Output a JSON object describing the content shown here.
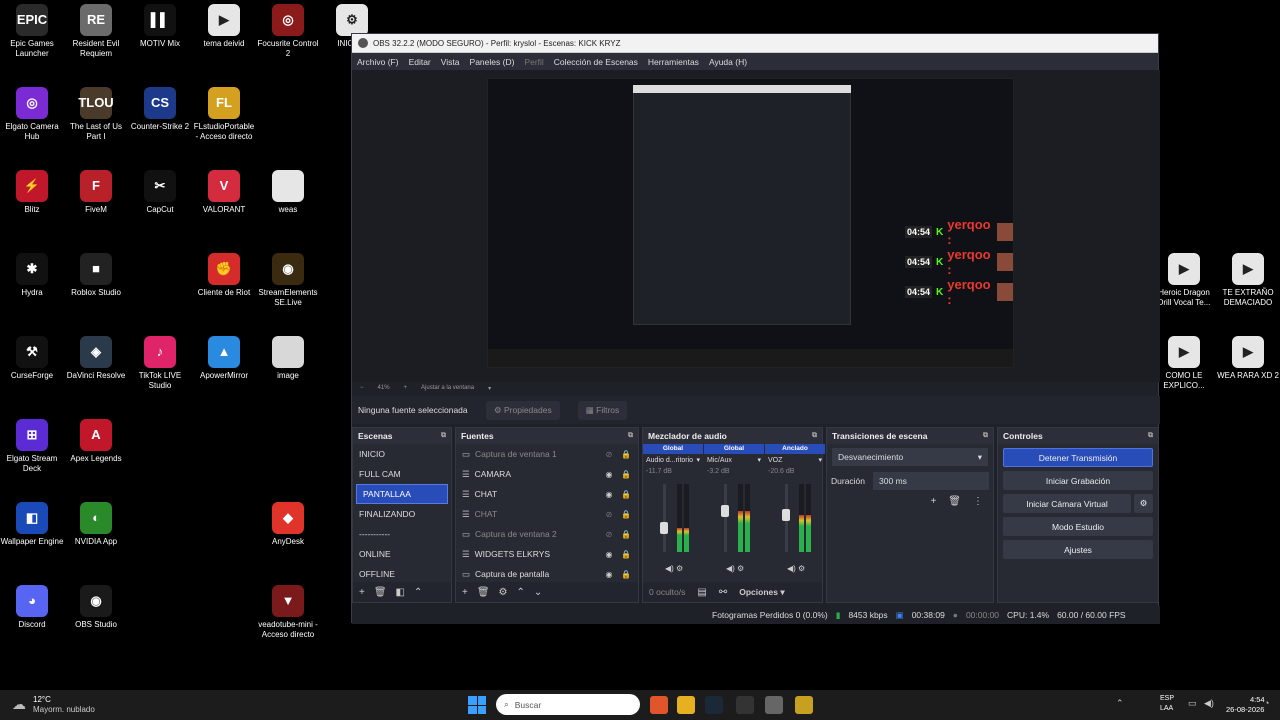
{
  "desktop": {
    "icons": [
      {
        "label": "Epic Games Launcher",
        "glyph": "EPIC",
        "color": "#2a2a2a"
      },
      {
        "label": "Resident Evil Requiem",
        "glyph": "RE",
        "color": "#6b6b6b"
      },
      {
        "label": "MOTIV Mix",
        "glyph": "▌▌",
        "color": "#111111"
      },
      {
        "label": "tema deivid",
        "glyph": "▶",
        "color": "#e6e6e6"
      },
      {
        "label": "Focusrite Control 2",
        "glyph": "◎",
        "color": "#8b1a1a"
      },
      {
        "label": "INICIAR",
        "glyph": "⚙",
        "color": "#e6e6e6"
      },
      {
        "label": "Elgato Camera Hub",
        "glyph": "◎",
        "color": "#7b2bd4"
      },
      {
        "label": "The Last of Us Part I",
        "glyph": "TLOU",
        "color": "#4a3a2a"
      },
      {
        "label": "Counter-Strike 2",
        "glyph": "CS",
        "color": "#1d3a8a"
      },
      {
        "label": "FLstudioPortable - Acceso directo",
        "glyph": "FL",
        "color": "#d4a020"
      },
      {
        "label": "Blitz",
        "glyph": "⚡",
        "color": "#c0182a"
      },
      {
        "label": "FiveM",
        "glyph": "F",
        "color": "#b8202a"
      },
      {
        "label": "CapCut",
        "glyph": "✂",
        "color": "#111111"
      },
      {
        "label": "VALORANT",
        "glyph": "V",
        "color": "#d42b3f"
      },
      {
        "label": "weas",
        "glyph": "",
        "color": "#e6e6e6"
      },
      {
        "label": "Hydra",
        "glyph": "✱",
        "color": "#111111"
      },
      {
        "label": "Roblox Studio",
        "glyph": "■",
        "color": "#222222"
      },
      {
        "label": "Cliente de Riot",
        "glyph": "✊",
        "color": "#d62b2b"
      },
      {
        "label": "StreamElements SE.Live",
        "glyph": "◉",
        "color": "#3a2a10"
      },
      {
        "label": "CurseForge",
        "glyph": "⚒",
        "color": "#111111"
      },
      {
        "label": "DaVinci Resolve",
        "glyph": "◈",
        "color": "#2a3a4a"
      },
      {
        "label": "TikTok LIVE Studio",
        "glyph": "♪",
        "color": "#e0246a"
      },
      {
        "label": "ApowerMirror",
        "glyph": "▲",
        "color": "#2a8ae0"
      },
      {
        "label": "image",
        "glyph": "",
        "color": "#d8d8d8"
      },
      {
        "label": "Elgato Stream Deck",
        "glyph": "⊞",
        "color": "#5b2bd4"
      },
      {
        "label": "Apex Legends",
        "glyph": "A",
        "color": "#c0182a"
      },
      {
        "label": "Wallpaper Engine",
        "glyph": "◧",
        "color": "#1a4ab8"
      },
      {
        "label": "NVIDIA App",
        "glyph": "◐",
        "color": "#2a8a2a"
      },
      {
        "label": "AnyDesk",
        "glyph": "◆",
        "color": "#e0342a"
      },
      {
        "label": "Discord",
        "glyph": "◕",
        "color": "#5865f2"
      },
      {
        "label": "OBS Studio",
        "glyph": "◉",
        "color": "#1a1a1a"
      },
      {
        "label": "veadotube-mini - Acceso directo",
        "glyph": "▼",
        "color": "#7a1a1a"
      },
      {
        "label": "Heroic Dragon Drill Vocal Te...",
        "glyph": "▶",
        "color": "#e6e6e6"
      },
      {
        "label": "TE EXTRAÑO DEMACIADO",
        "glyph": "▶",
        "color": "#e6e6e6"
      },
      {
        "label": "COMO LE EXPLICO...",
        "glyph": "▶",
        "color": "#e6e6e6"
      },
      {
        "label": "WEA RARA XD 2",
        "glyph": "▶",
        "color": "#e6e6e6"
      }
    ]
  },
  "obs": {
    "title": "OBS 32.2.2 (MODO SEGURO) - Perfil: kryslol - Escenas: KICK KRYZ",
    "menu": [
      "Archivo (F)",
      "Editar",
      "Vista",
      "Paneles (D)",
      "Perfil",
      "Colección de Escenas",
      "Herramientas",
      "Ayuda (H)"
    ],
    "zoom": "41%",
    "zoom_fit": "Ajustar a la ventana",
    "no_source": "Ninguna fuente seleccionada",
    "properties": "Propiedades",
    "filters": "Filtros",
    "scenes": {
      "title": "Escenas",
      "items": [
        "INICIO",
        "FULL CAM",
        "PANTALLAA",
        "FINALIZANDO",
        "-----------",
        "ONLINE",
        "OFFLINE"
      ],
      "selected": 2
    },
    "sources": {
      "title": "Fuentes",
      "items": [
        {
          "name": "Captura de ventana 1",
          "visible": false
        },
        {
          "name": "CAMARA",
          "visible": true
        },
        {
          "name": "CHAT",
          "visible": true
        },
        {
          "name": "CHAT",
          "visible": false
        },
        {
          "name": "Captura de ventana 2",
          "visible": false
        },
        {
          "name": "WIDGETS ELKRYS",
          "visible": true
        },
        {
          "name": "Captura de pantalla",
          "visible": true
        }
      ]
    },
    "mixer": {
      "title": "Mezclador de audio",
      "channels": [
        {
          "group": "Global",
          "name": "Audio d...ritorio",
          "db": "-11.7 dB",
          "level": 0.35
        },
        {
          "group": "Global",
          "name": "Mic/Aux",
          "db": "-3.2 dB",
          "level": 0.6
        },
        {
          "group": "Anclado",
          "name": "VOZ",
          "db": "-20.6 dB",
          "level": 0.55
        }
      ],
      "hidden": "0 oculto/s",
      "options": "Opciones"
    },
    "transitions": {
      "title": "Transiciones de escena",
      "selected": "Desvanecimiento",
      "duration_label": "Duración",
      "duration": "300 ms"
    },
    "controls": {
      "title": "Controles",
      "stream": "Detener Transmisión",
      "record": "Iniciar Grabación",
      "vcam": "Iniciar Cámara Virtual",
      "studio": "Modo Estudio",
      "settings": "Ajustes"
    },
    "status": {
      "dropped": "Fotogramas Perdidos 0 (0.0%)",
      "bitrate": "8453 kbps",
      "stream_time": "00:38:09",
      "rec_time": "00:00:00",
      "cpu": "CPU: 1.4%",
      "fps": "60.00 / 60.00 FPS"
    }
  },
  "overlay": {
    "chat": [
      {
        "time": "04:54",
        "user": "yerqoo :"
      },
      {
        "time": "04:54",
        "user": "yerqoo :"
      },
      {
        "time": "04:54",
        "user": "yerqoo :"
      }
    ]
  },
  "taskbar": {
    "weather_temp": "12°C",
    "weather_desc": "Mayorm. nublado",
    "search": "Buscar",
    "lang1": "ESP",
    "lang2": "LAA",
    "time": "4:54",
    "date": "26-08-2026"
  }
}
